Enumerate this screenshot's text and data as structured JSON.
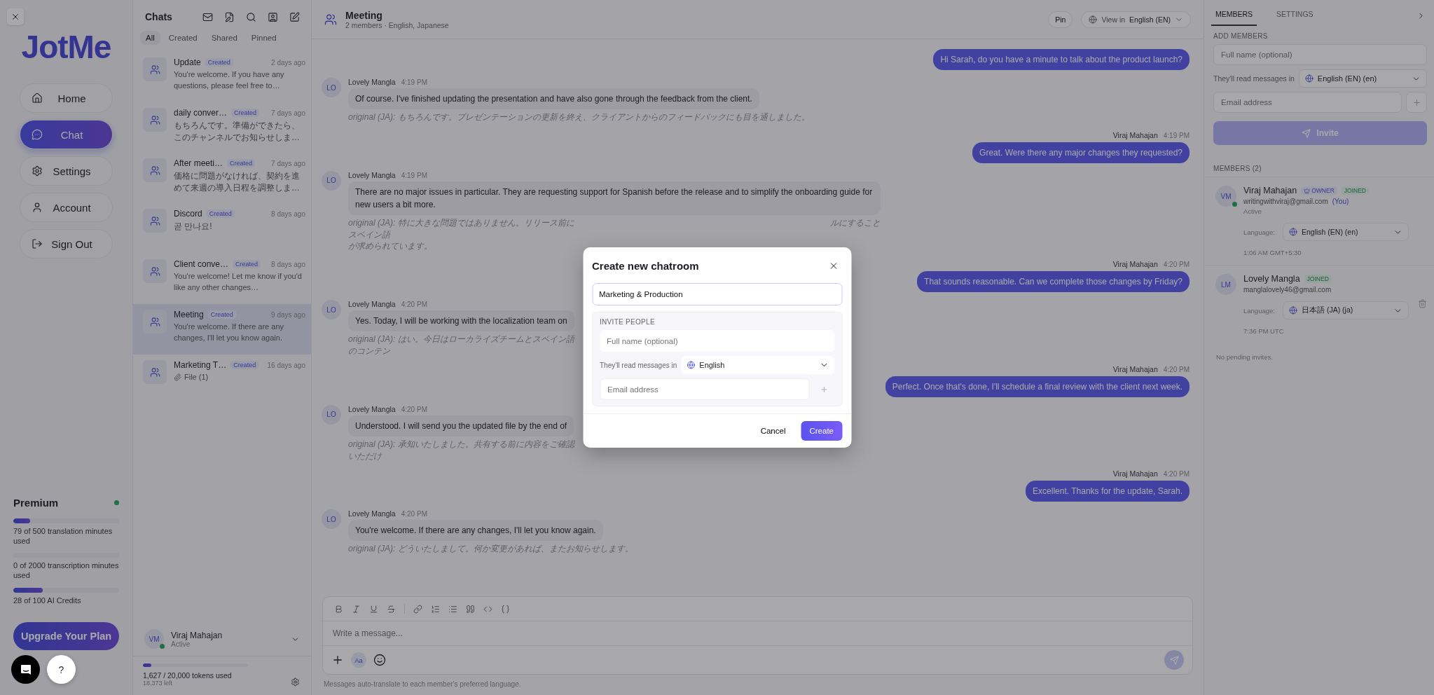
{
  "nav": {
    "logo": "JotMe",
    "items": [
      {
        "kind": "home",
        "label": "Home",
        "selected": false
      },
      {
        "kind": "chat",
        "label": "Chat",
        "selected": true
      },
      {
        "kind": "settings",
        "label": "Settings",
        "selected": false
      },
      {
        "kind": "account",
        "label": "Account",
        "selected": false
      },
      {
        "kind": "signout",
        "label": "Sign Out",
        "selected": false
      }
    ]
  },
  "plan": {
    "name": "Premium",
    "meters": [
      {
        "level": 0.16,
        "label": "79 of 500 translation minutes used"
      },
      {
        "label": "0 of 2000 transcription minutes used"
      },
      {
        "level": 0.28,
        "label": "28 of 100 AI Credits"
      }
    ],
    "upgrade": "Upgrade Your Plan"
  },
  "help": {
    "label": "?"
  },
  "chats": {
    "title": "Chats",
    "tabs": [
      {
        "label": "All",
        "selected": true
      },
      {
        "label": "Created",
        "selected": false
      },
      {
        "label": "Shared",
        "selected": false
      },
      {
        "label": "Pinned",
        "selected": false
      }
    ],
    "items": [
      {
        "title": "Update",
        "badge": "Created",
        "time": "2 days ago",
        "preview": "You're welcome. If you have any questions, please feel free to…",
        "selected": false
      },
      {
        "title": "daily conver…",
        "badge": "Created",
        "time": "7 days ago",
        "preview": "もちろんです。準備ができたら、このチャンネルでお知らせしま…",
        "selected": false
      },
      {
        "title": "After meeti…",
        "badge": "Created",
        "time": "7 days ago",
        "preview": "価格に問題がなければ、契約を進めて来週の導入日程を調整しま…",
        "selected": false
      },
      {
        "title": "Discord",
        "badge": "Created",
        "time": "8 days ago",
        "preview": "곧 만나요!",
        "selected": false
      },
      {
        "title": "Client conve…",
        "badge": "Created",
        "time": "8 days ago",
        "preview": "You're welcome! Let me know if you'd like any other changes…",
        "selected": false
      },
      {
        "title": "Meeting",
        "badge": "Created",
        "time": "9 days ago",
        "preview": "You're welcome. If there are any changes, I'll let you know again.",
        "selected": true
      },
      {
        "title": "Marketing T…",
        "badge": "Created",
        "time": "16 days ago",
        "attachment": "File (1)",
        "selected": false
      }
    ],
    "user": {
      "initials": "VM",
      "name": "Viraj Mahajan",
      "status": "Active"
    },
    "tokens": {
      "level": 0.08,
      "used": "1,627 / 20,000 tokens used",
      "left": "18,373 left"
    }
  },
  "room": {
    "title": "Meeting",
    "subtitle": "2 members · English, Japanese",
    "pin": "Pin",
    "view_label": "View in",
    "view_value": "English (EN)"
  },
  "messages": [
    {
      "kind": "outgoing",
      "text": "Hi Sarah, do you have a minute to talk about the product launch?"
    },
    {
      "kind": "incoming",
      "initials": "LO",
      "author": "Lovely Mangla",
      "time": "4:19 PM",
      "text": "Of course. I've finished updating the presentation and have also gone through the feedback from the client.",
      "original": [
        [
          "original (JA): もちろんです。プレゼンテーションの更新を終え、クライアントからのフィードバックにも目を通しました。"
        ]
      ]
    },
    {
      "kind": "outgoing",
      "author": "Viraj Mahajan",
      "time": "4:19 PM",
      "text": "Great. Were there any major changes they requested?"
    },
    {
      "kind": "incoming",
      "initials": "LO",
      "author": "Lovely Mangla",
      "time": "4:19 PM",
      "hidden_by_dialog": true,
      "text": "There are no major issues in particular. They are requesting support for Spanish before the release and to simplify the onboarding guide for new users a bit more.",
      "original": [
        [
          "original (JA): 特に大きな問題ではありません。リリース前にスペイン語",
          "ルにすること"
        ],
        [
          "が求められています。"
        ]
      ]
    },
    {
      "kind": "outgoing",
      "author": "Viraj Mahajan",
      "time": "4:20 PM",
      "text": "That sounds reasonable. Can we complete those changes by Friday?"
    },
    {
      "kind": "incoming",
      "initials": "LO",
      "author": "Lovely Mangla",
      "time": "4:20 PM",
      "hidden_by_dialog": true,
      "text": "Yes. Today, I will be working with the localization team on",
      "original": [
        [
          "original (JA): はい。今日はローカライズチームとスペイン語のコンテン"
        ]
      ]
    },
    {
      "kind": "outgoing",
      "author": "Viraj Mahajan",
      "time": "4:20 PM",
      "text": "Perfect. Once that's done, I'll schedule a final review with the client next week."
    },
    {
      "kind": "incoming",
      "initials": "LO",
      "author": "Lovely Mangla",
      "time": "4:20 PM",
      "hidden_by_dialog": true,
      "text": "Understood. I will send you the updated file by the end of",
      "original": [
        [
          "original (JA): 承知いたしました。共有する前に内容をご確認いただけ"
        ]
      ]
    },
    {
      "kind": "outgoing",
      "author": "Viraj Mahajan",
      "time": "4:20 PM",
      "text": "Excellent. Thanks for the update, Sarah."
    },
    {
      "kind": "incoming",
      "initials": "LO",
      "author": "Lovely Mangla",
      "time": "4:20 PM",
      "text": "You're welcome. If there are any changes, I'll let you know again.",
      "original": [
        [
          "original (JA): どういたしまして。何か変更があれば、またお知らせします。"
        ]
      ]
    }
  ],
  "composer": {
    "placeholder": "Write a message...",
    "font_button": "Aa",
    "note": "Messages auto-translate to each member's preferred language."
  },
  "panel": {
    "tabs": [
      {
        "label": "MEMBERS",
        "selected": true
      },
      {
        "label": "SETTINGS",
        "selected": false
      }
    ],
    "add_title": "ADD MEMBERS",
    "name_placeholder": "Full name (optional)",
    "reads_label": "They'll read messages in",
    "reads_value": "English (EN) (en)",
    "email_placeholder": "Email address",
    "invite": "Invite",
    "members_title": "MEMBERS (2)",
    "members": [
      {
        "initials": "VM",
        "name": "Viraj Mahajan",
        "role": "OWNER",
        "status": "JOINED",
        "email": "writingwithviraj@gmail.com",
        "you": "(You)",
        "presence": "Active",
        "language_label": "Language:",
        "language": "English (EN) (en)",
        "local_time": "1:06 AM GMT+5:30",
        "online": true,
        "removable": false
      },
      {
        "initials": "LM",
        "name": "Lovely Mangla",
        "status": "JOINED",
        "email": "manglalovely46@gmail.com",
        "language_label": "Language:",
        "language": "日本語 (JA) (ja)",
        "local_time": "7:36 PM UTC",
        "online": false,
        "removable": true
      }
    ],
    "pending": "No pending invites."
  },
  "dialog": {
    "title": "Create new chatroom",
    "name_value": "Marketing & Production",
    "invite_title": "INVITE PEOPLE",
    "name_placeholder": "Full name (optional)",
    "reads_label": "They'll read messages in",
    "reads_value": "English",
    "email_placeholder": "Email address",
    "cancel": "Cancel",
    "create": "Create"
  }
}
